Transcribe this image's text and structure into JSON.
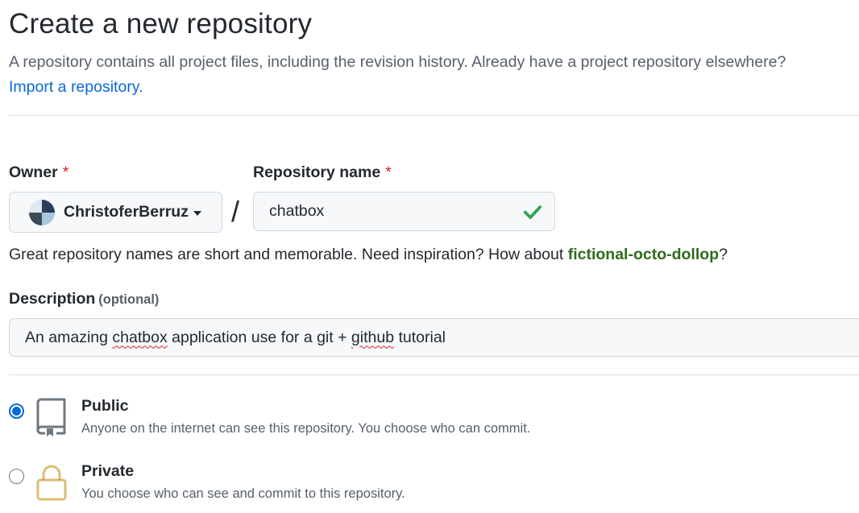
{
  "header": {
    "title": "Create a new repository",
    "subtitle": "A repository contains all project files, including the revision history. Already have a project repository elsewhere?",
    "import_link": "Import a repository."
  },
  "owner": {
    "label": "Owner",
    "required_mark": "*",
    "value": "ChristoferBerruz"
  },
  "separator": "/",
  "repo_name": {
    "label": "Repository name",
    "required_mark": "*",
    "value": "chatbox",
    "valid": true
  },
  "name_hint": {
    "prefix": "Great repository names are short and memorable. Need inspiration? How about ",
    "suggestion": "fictional-octo-dollop",
    "suffix": "?"
  },
  "description": {
    "label": "Description",
    "optional": "(optional)",
    "value_parts": [
      "An amazing ",
      "chatbox",
      " application use for a git + ",
      "github",
      " tutorial"
    ]
  },
  "visibility": {
    "selected": "public",
    "options": [
      {
        "id": "public",
        "title": "Public",
        "description": "Anyone on the internet can see this repository. You choose who can commit.",
        "icon": "repo-icon"
      },
      {
        "id": "private",
        "title": "Private",
        "description": "You choose who can see and commit to this repository.",
        "icon": "lock-icon"
      }
    ]
  },
  "colors": {
    "link": "#0969da",
    "required": "#cf222e",
    "success": "#2da44e",
    "suggestion": "#2f6b1e",
    "radio_selected": "#0969da",
    "private_icon": "#bf8700"
  }
}
